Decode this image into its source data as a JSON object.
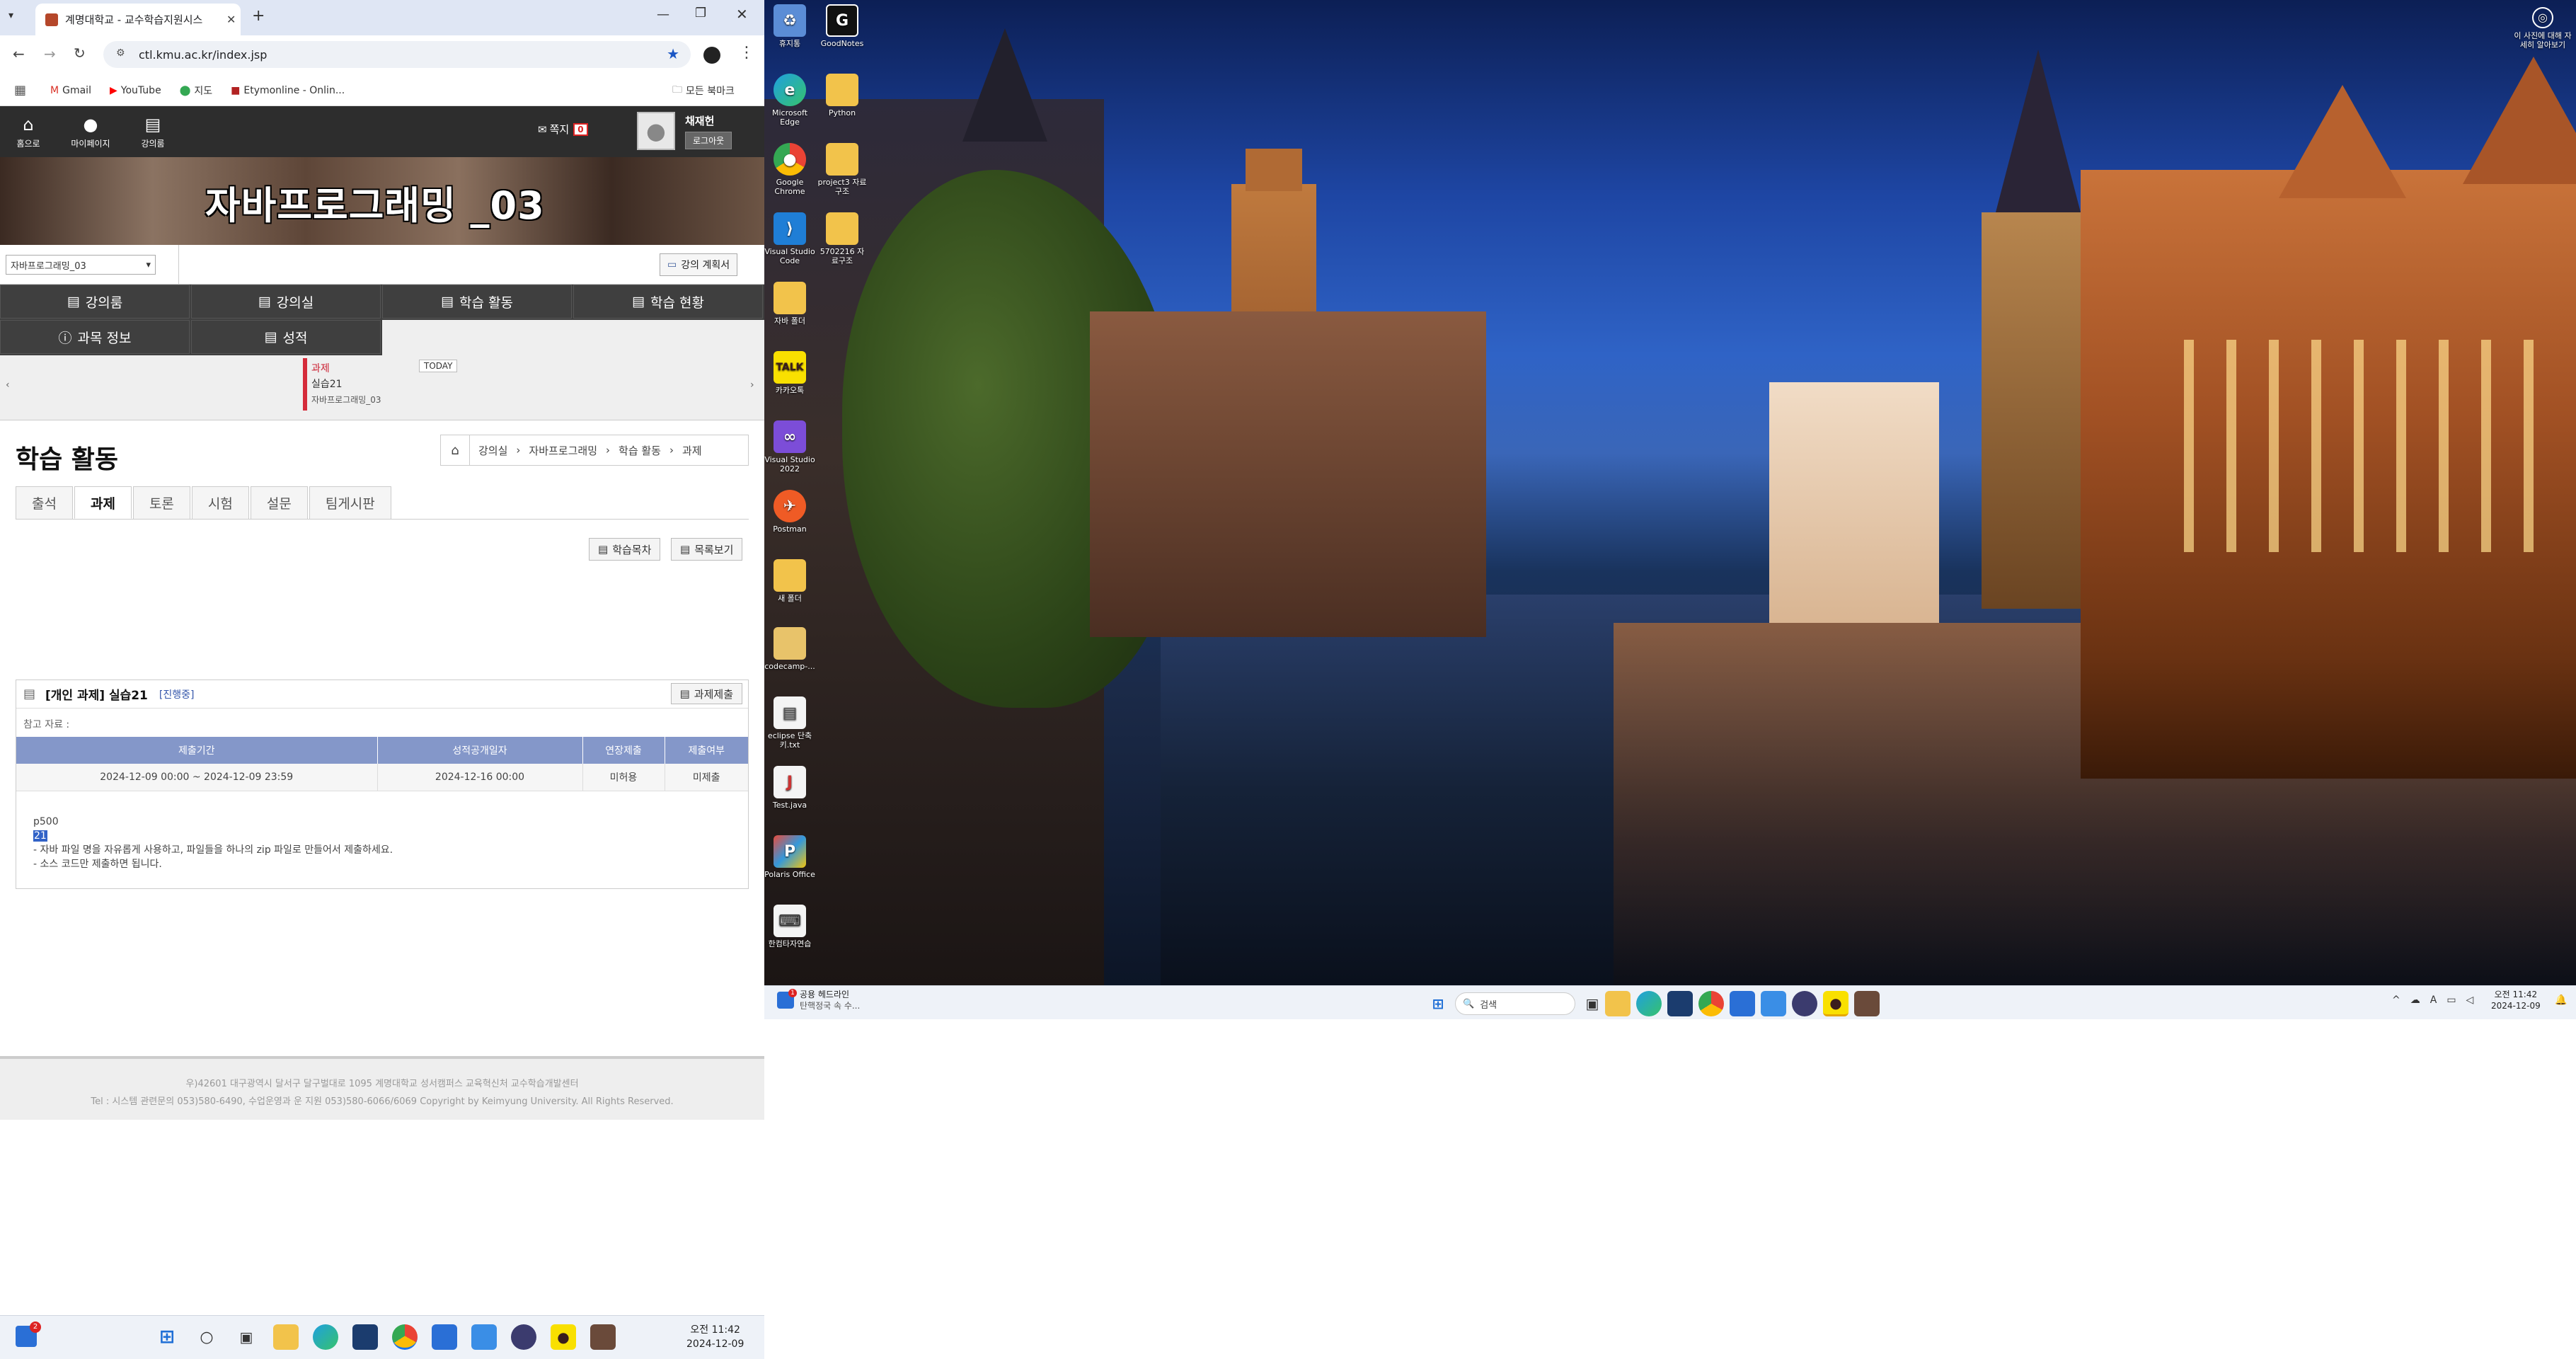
{
  "browser": {
    "tab_title": "계명대학교 - 교수학습지원시스",
    "url": "ctl.kmu.ac.kr/index.jsp",
    "bookmarks": [
      "Gmail",
      "YouTube",
      "지도",
      "Etymonline - Onlin..."
    ],
    "all_bookmarks": "모든 북마크"
  },
  "site": {
    "nav": [
      "홈으로",
      "마이페이지",
      "강의룸"
    ],
    "note_label": "쪽지",
    "note_count": "0",
    "user_name": "채재헌",
    "logout": "로그아웃",
    "course_title": "자바프로그래밍 _03",
    "course_select": "자바프로그래밍_03",
    "plan_button": "강의 계획서",
    "menu": [
      "강의룸",
      "강의실",
      "학습 활동",
      "학습 현황",
      "과목 정보",
      "성적"
    ],
    "calendar": {
      "today": "TODAY",
      "event_type": "과제",
      "event_name": "실습21",
      "event_course": "자바프로그래밍_03"
    },
    "page_title": "학습 활동",
    "breadcrumb": [
      "강의실",
      "자바프로그래밍",
      "학습 활동",
      "과제"
    ],
    "subtabs": [
      "출석",
      "과제",
      "토론",
      "시험",
      "설문",
      "팀게시판"
    ],
    "buttons": {
      "learners": "학습목차",
      "list": "목록보기",
      "submit": "과제제출"
    },
    "assignment": {
      "title": "[개인 과제] 실습21",
      "status": "[진행중]",
      "ref_label": "참고 자료 :",
      "headers": [
        "제출기간",
        "성적공개일자",
        "연장제출",
        "제출여부"
      ],
      "row": [
        "2024-12-09 00:00 ~ 2024-12-09 23:59",
        "2024-12-16 00:00",
        "미허용",
        "미제출"
      ],
      "body_line1": "p500",
      "body_line2": "21",
      "body_line3": "- 자바 파일 명을 자유롭게 사용하고, 파일들을 하나의 zip 파일로 만들어서 제출하세요.",
      "body_line4": "- 소스 코드만 제출하면 됩니다."
    },
    "footer1": "우)42601 대구광역시 달서구 달구벌대로 1095 계명대학교 성서캠퍼스 교육혁신처 교수학습개발센터",
    "footer2": "Tel : 시스템 관련문의 053)580-6490, 수업운영과 운 지원 053)580-6066/6069 Copyright by Keimyung University. All Rights Reserved."
  },
  "desktop": {
    "icons": [
      "휴지통",
      "GoodNotes",
      "Microsoft Edge",
      "Python",
      "Google Chrome",
      "project3 자료구조",
      "Visual Studio Code",
      "5702216 자료구조",
      "자바 폴더",
      "카카오톡",
      "Visual Studio 2022",
      "Postman",
      "새 폴더",
      "codecamp-...",
      "eclipse 단축키.txt",
      "Test.java",
      "Polaris Office",
      "한컴타자연습"
    ],
    "corner_label": "이 사진에 대해 자세히 알아보기"
  },
  "taskbar_right": {
    "news": "공용 헤드라인",
    "news_sub": "탄핵정국 속 수...",
    "search": "검색",
    "time": "오전 11:42",
    "date": "2024-12-09"
  },
  "taskbar_left": {
    "badge": "2",
    "time": "오전 11:42",
    "date": "2024-12-09"
  },
  "colors": {
    "accent": "#1a73e8",
    "table_header": "#8497c9",
    "status": "#3355aa"
  }
}
